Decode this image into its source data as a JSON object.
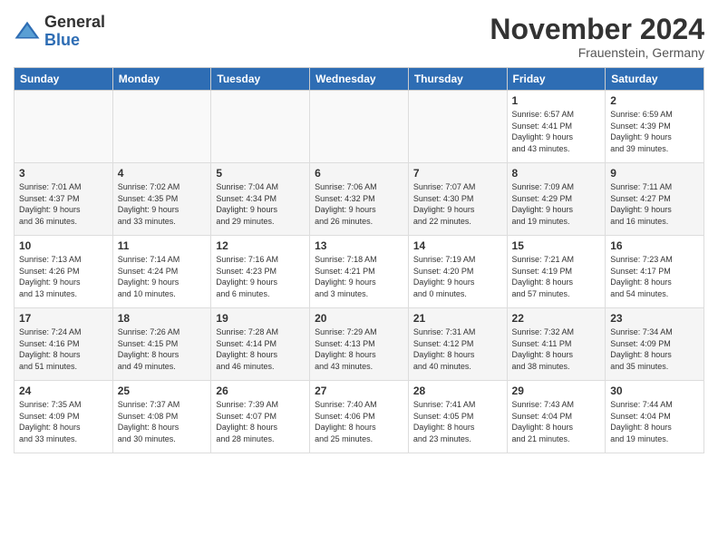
{
  "header": {
    "logo_general": "General",
    "logo_blue": "Blue",
    "month_title": "November 2024",
    "location": "Frauenstein, Germany"
  },
  "weekdays": [
    "Sunday",
    "Monday",
    "Tuesday",
    "Wednesday",
    "Thursday",
    "Friday",
    "Saturday"
  ],
  "weeks": [
    [
      {
        "day": "",
        "info": ""
      },
      {
        "day": "",
        "info": ""
      },
      {
        "day": "",
        "info": ""
      },
      {
        "day": "",
        "info": ""
      },
      {
        "day": "",
        "info": ""
      },
      {
        "day": "1",
        "info": "Sunrise: 6:57 AM\nSunset: 4:41 PM\nDaylight: 9 hours\nand 43 minutes."
      },
      {
        "day": "2",
        "info": "Sunrise: 6:59 AM\nSunset: 4:39 PM\nDaylight: 9 hours\nand 39 minutes."
      }
    ],
    [
      {
        "day": "3",
        "info": "Sunrise: 7:01 AM\nSunset: 4:37 PM\nDaylight: 9 hours\nand 36 minutes."
      },
      {
        "day": "4",
        "info": "Sunrise: 7:02 AM\nSunset: 4:35 PM\nDaylight: 9 hours\nand 33 minutes."
      },
      {
        "day": "5",
        "info": "Sunrise: 7:04 AM\nSunset: 4:34 PM\nDaylight: 9 hours\nand 29 minutes."
      },
      {
        "day": "6",
        "info": "Sunrise: 7:06 AM\nSunset: 4:32 PM\nDaylight: 9 hours\nand 26 minutes."
      },
      {
        "day": "7",
        "info": "Sunrise: 7:07 AM\nSunset: 4:30 PM\nDaylight: 9 hours\nand 22 minutes."
      },
      {
        "day": "8",
        "info": "Sunrise: 7:09 AM\nSunset: 4:29 PM\nDaylight: 9 hours\nand 19 minutes."
      },
      {
        "day": "9",
        "info": "Sunrise: 7:11 AM\nSunset: 4:27 PM\nDaylight: 9 hours\nand 16 minutes."
      }
    ],
    [
      {
        "day": "10",
        "info": "Sunrise: 7:13 AM\nSunset: 4:26 PM\nDaylight: 9 hours\nand 13 minutes."
      },
      {
        "day": "11",
        "info": "Sunrise: 7:14 AM\nSunset: 4:24 PM\nDaylight: 9 hours\nand 10 minutes."
      },
      {
        "day": "12",
        "info": "Sunrise: 7:16 AM\nSunset: 4:23 PM\nDaylight: 9 hours\nand 6 minutes."
      },
      {
        "day": "13",
        "info": "Sunrise: 7:18 AM\nSunset: 4:21 PM\nDaylight: 9 hours\nand 3 minutes."
      },
      {
        "day": "14",
        "info": "Sunrise: 7:19 AM\nSunset: 4:20 PM\nDaylight: 9 hours\nand 0 minutes."
      },
      {
        "day": "15",
        "info": "Sunrise: 7:21 AM\nSunset: 4:19 PM\nDaylight: 8 hours\nand 57 minutes."
      },
      {
        "day": "16",
        "info": "Sunrise: 7:23 AM\nSunset: 4:17 PM\nDaylight: 8 hours\nand 54 minutes."
      }
    ],
    [
      {
        "day": "17",
        "info": "Sunrise: 7:24 AM\nSunset: 4:16 PM\nDaylight: 8 hours\nand 51 minutes."
      },
      {
        "day": "18",
        "info": "Sunrise: 7:26 AM\nSunset: 4:15 PM\nDaylight: 8 hours\nand 49 minutes."
      },
      {
        "day": "19",
        "info": "Sunrise: 7:28 AM\nSunset: 4:14 PM\nDaylight: 8 hours\nand 46 minutes."
      },
      {
        "day": "20",
        "info": "Sunrise: 7:29 AM\nSunset: 4:13 PM\nDaylight: 8 hours\nand 43 minutes."
      },
      {
        "day": "21",
        "info": "Sunrise: 7:31 AM\nSunset: 4:12 PM\nDaylight: 8 hours\nand 40 minutes."
      },
      {
        "day": "22",
        "info": "Sunrise: 7:32 AM\nSunset: 4:11 PM\nDaylight: 8 hours\nand 38 minutes."
      },
      {
        "day": "23",
        "info": "Sunrise: 7:34 AM\nSunset: 4:09 PM\nDaylight: 8 hours\nand 35 minutes."
      }
    ],
    [
      {
        "day": "24",
        "info": "Sunrise: 7:35 AM\nSunset: 4:09 PM\nDaylight: 8 hours\nand 33 minutes."
      },
      {
        "day": "25",
        "info": "Sunrise: 7:37 AM\nSunset: 4:08 PM\nDaylight: 8 hours\nand 30 minutes."
      },
      {
        "day": "26",
        "info": "Sunrise: 7:39 AM\nSunset: 4:07 PM\nDaylight: 8 hours\nand 28 minutes."
      },
      {
        "day": "27",
        "info": "Sunrise: 7:40 AM\nSunset: 4:06 PM\nDaylight: 8 hours\nand 25 minutes."
      },
      {
        "day": "28",
        "info": "Sunrise: 7:41 AM\nSunset: 4:05 PM\nDaylight: 8 hours\nand 23 minutes."
      },
      {
        "day": "29",
        "info": "Sunrise: 7:43 AM\nSunset: 4:04 PM\nDaylight: 8 hours\nand 21 minutes."
      },
      {
        "day": "30",
        "info": "Sunrise: 7:44 AM\nSunset: 4:04 PM\nDaylight: 8 hours\nand 19 minutes."
      }
    ]
  ]
}
